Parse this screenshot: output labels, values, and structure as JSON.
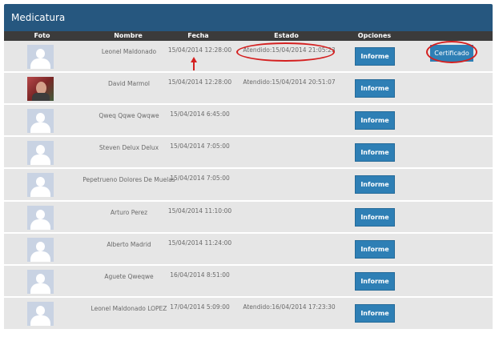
{
  "title": "Medicatura",
  "headers": {
    "foto": "Foto",
    "nombre": "Nombre",
    "fecha": "Fecha",
    "estado": "Estado",
    "opciones": "Opciones"
  },
  "button_label": "Informe",
  "certificado_label": "Certificado",
  "colors": {
    "title_bar": "#26577f",
    "header_row": "#3b3b3b",
    "button": "#2e7fb5",
    "annotation": "#d42020"
  },
  "rows": [
    {
      "nombre": "Leonel Maldonado",
      "fecha": "15/04/2014 12:28:00",
      "estado": "Atendido:15/04/2014 21:05:23",
      "avatar": "placeholder-avatar"
    },
    {
      "nombre": "David Marmol",
      "fecha": "15/04/2014 12:28:00",
      "estado": "Atendido:15/04/2014 20:51:07",
      "avatar": "photo-avatar"
    },
    {
      "nombre": "Qweq Qqwe Qwqwe",
      "fecha": "15/04/2014 6:45:00",
      "estado": "",
      "avatar": "placeholder-avatar"
    },
    {
      "nombre": "Steven Delux Delux",
      "fecha": "15/04/2014 7:05:00",
      "estado": "",
      "avatar": "placeholder-avatar"
    },
    {
      "nombre": "Pepetrueno Dolores De Muelas",
      "fecha": "15/04/2014 7:05:00",
      "estado": "",
      "avatar": "placeholder-avatar"
    },
    {
      "nombre": "Arturo Perez",
      "fecha": "15/04/2014 11:10:00",
      "estado": "",
      "avatar": "placeholder-avatar"
    },
    {
      "nombre": "Alberto Madrid",
      "fecha": "15/04/2014 11:24:00",
      "estado": "",
      "avatar": "placeholder-avatar"
    },
    {
      "nombre": "Aguete Qweqwe",
      "fecha": "16/04/2014 8:51:00",
      "estado": "",
      "avatar": "placeholder-avatar"
    },
    {
      "nombre": "Leonel Maldonado LOPEZ",
      "fecha": "17/04/2014 5:09:00",
      "estado": "Atendido:16/04/2014 17:23:30",
      "avatar": "placeholder-avatar"
    }
  ]
}
